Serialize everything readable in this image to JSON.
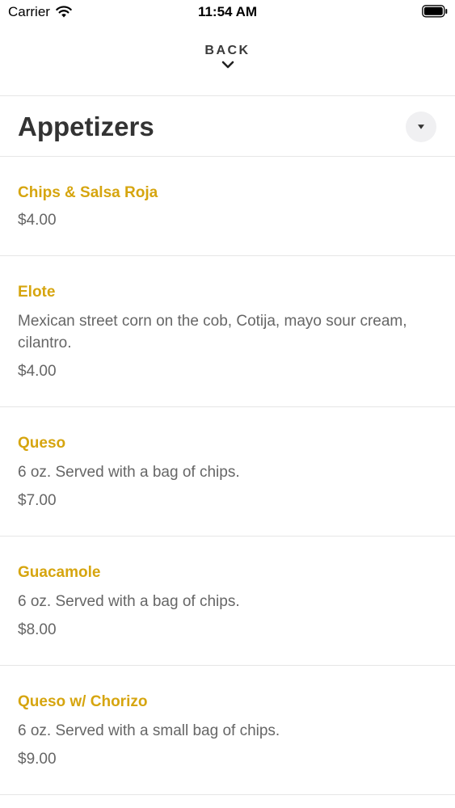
{
  "status_bar": {
    "carrier": "Carrier",
    "time": "11:54 AM"
  },
  "nav": {
    "back_label": "BACK"
  },
  "section": {
    "title": "Appetizers"
  },
  "theme": {
    "accent": "#d6a50f",
    "text": "#333333",
    "muted": "#666666"
  },
  "items": [
    {
      "name": "Chips & Salsa Roja",
      "description": "",
      "price": "$4.00"
    },
    {
      "name": "Elote",
      "description": "Mexican street corn on the cob, Cotija, mayo sour cream, cilantro.",
      "price": "$4.00"
    },
    {
      "name": "Queso",
      "description": "6 oz. Served with a bag of chips.",
      "price": "$7.00"
    },
    {
      "name": "Guacamole",
      "description": "6 oz. Served with a bag of chips.",
      "price": "$8.00"
    },
    {
      "name": "Queso w/ Chorizo",
      "description": "6 oz. Served with a small bag of chips.",
      "price": "$9.00"
    }
  ]
}
